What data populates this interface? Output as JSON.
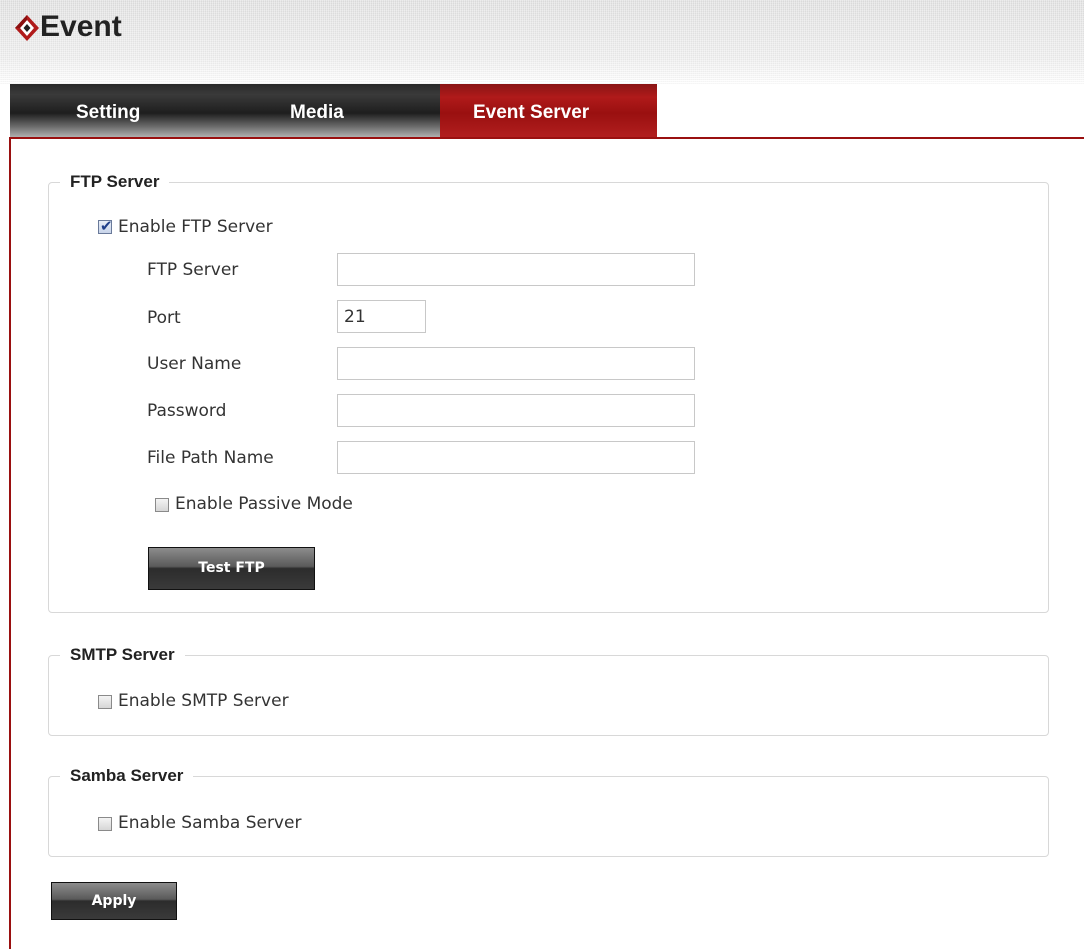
{
  "header": {
    "title": "Event",
    "logo_icon": "diamond-logo-icon"
  },
  "tabs": [
    {
      "label": "Setting",
      "active": false
    },
    {
      "label": "Media",
      "active": false
    },
    {
      "label": "Event Server",
      "active": true
    }
  ],
  "colors": {
    "accent": "#9a1010",
    "tab_dark": "#2a2a2a",
    "button": "#3a3a3a"
  },
  "ftp": {
    "legend": "FTP Server",
    "enable_label": "Enable FTP Server",
    "enabled": true,
    "fields": {
      "server_label": "FTP Server",
      "server_value": "",
      "port_label": "Port",
      "port_value": "21",
      "username_label": "User Name",
      "username_value": "",
      "password_label": "Password",
      "password_value": "",
      "path_label": "File Path Name",
      "path_value": ""
    },
    "passive_label": "Enable Passive Mode",
    "passive_enabled": false,
    "test_button": "Test FTP"
  },
  "smtp": {
    "legend": "SMTP Server",
    "enable_label": "Enable SMTP Server",
    "enabled": false
  },
  "samba": {
    "legend": "Samba Server",
    "enable_label": "Enable Samba Server",
    "enabled": false
  },
  "apply_button": "Apply"
}
